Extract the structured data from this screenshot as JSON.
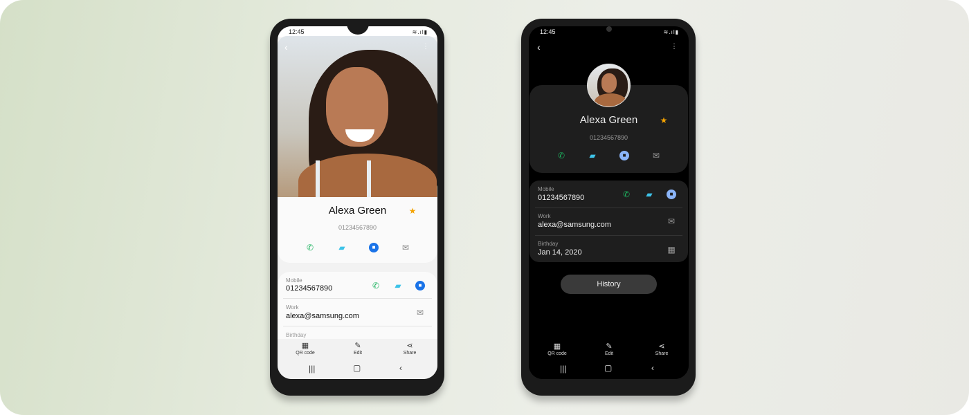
{
  "time": "12:45",
  "contact": {
    "name": "Alexa Green",
    "number": "01234567890",
    "fields": [
      {
        "label": "Mobile",
        "value": "01234567890"
      },
      {
        "label": "Work",
        "value": "alexa@samsung.com"
      },
      {
        "label": "Birthday",
        "value": "Jan 14, 2020"
      }
    ]
  },
  "bottom_bar": {
    "qr": "QR code",
    "edit": "Edit",
    "share": "Share"
  },
  "history_label": "History",
  "colors": {
    "call": "#1db35f",
    "message": "#3ec3e8",
    "video": "#1a73e8",
    "star": "#f5a300",
    "dark_bg": "#000000",
    "dark_card": "#1e1e1e"
  }
}
